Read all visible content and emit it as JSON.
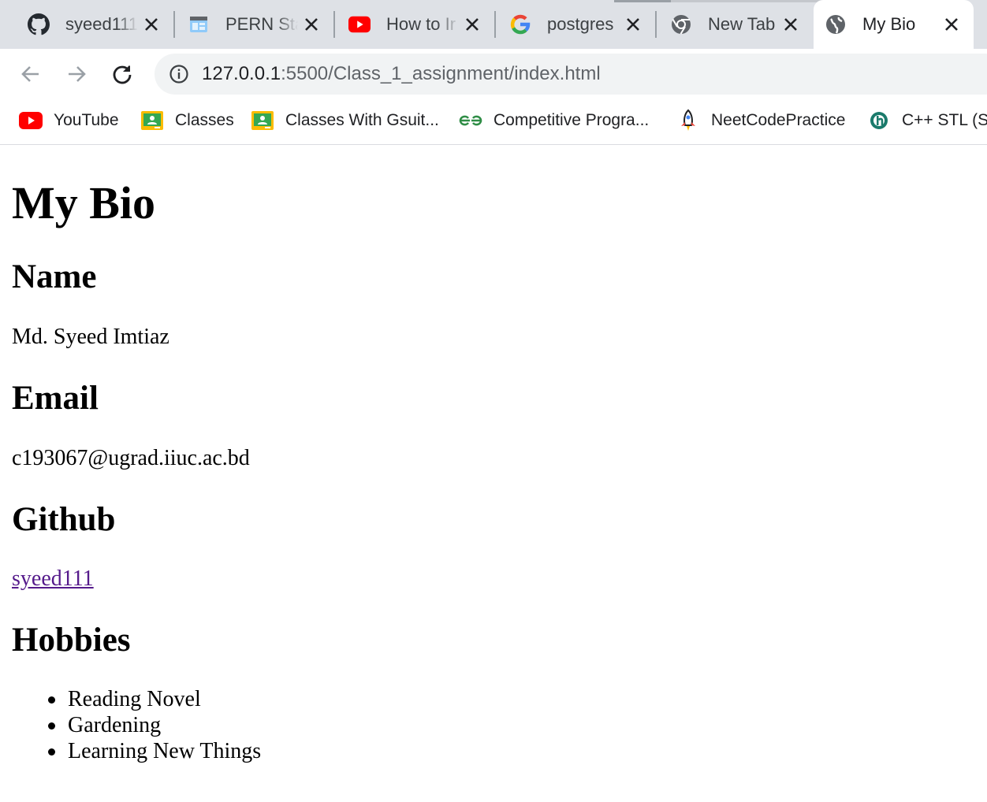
{
  "browser": {
    "tabs": [
      {
        "title": "syeed111",
        "icon": "github-icon",
        "active": false
      },
      {
        "title": "PERN Sta",
        "icon": "webpage-icon",
        "active": false
      },
      {
        "title": "How to Ir",
        "icon": "youtube-icon",
        "active": false
      },
      {
        "title": "postgres",
        "icon": "google-icon",
        "active": false
      },
      {
        "title": "New Tab",
        "icon": "chrome-icon",
        "active": false
      },
      {
        "title": "My Bio",
        "icon": "globe-icon",
        "active": true
      }
    ],
    "address": {
      "host": "127.0.0.1",
      "path": ":5500/Class_1_assignment/index.html"
    },
    "bookmarks": [
      {
        "label": "YouTube",
        "icon": "youtube-icon"
      },
      {
        "label": "Classes",
        "icon": "classroom-icon"
      },
      {
        "label": "Classes With Gsuit...",
        "icon": "classroom-icon"
      },
      {
        "label": "Competitive Progra...",
        "icon": "geeksforgeeks-icon"
      },
      {
        "label": "NeetCodePractice",
        "icon": "rocket-icon"
      },
      {
        "label": "C++ STL (St",
        "icon": "site-icon"
      }
    ],
    "colors": {
      "tabstrip": "#dee1e6",
      "omnibox": "#f1f3f4",
      "link": "#551a8b",
      "youtube": "#ff0000"
    }
  },
  "page": {
    "heading": "My Bio",
    "sections": [
      {
        "title": "Name",
        "value": "Md. Syeed Imtiaz"
      },
      {
        "title": "Email",
        "value": "c193067@ugrad.iiuc.ac.bd"
      },
      {
        "title": "Github",
        "value": "syeed111"
      },
      {
        "title": "Hobbies"
      }
    ],
    "hobbies": [
      "Reading Novel",
      "Gardening",
      "Learning New Things"
    ]
  }
}
